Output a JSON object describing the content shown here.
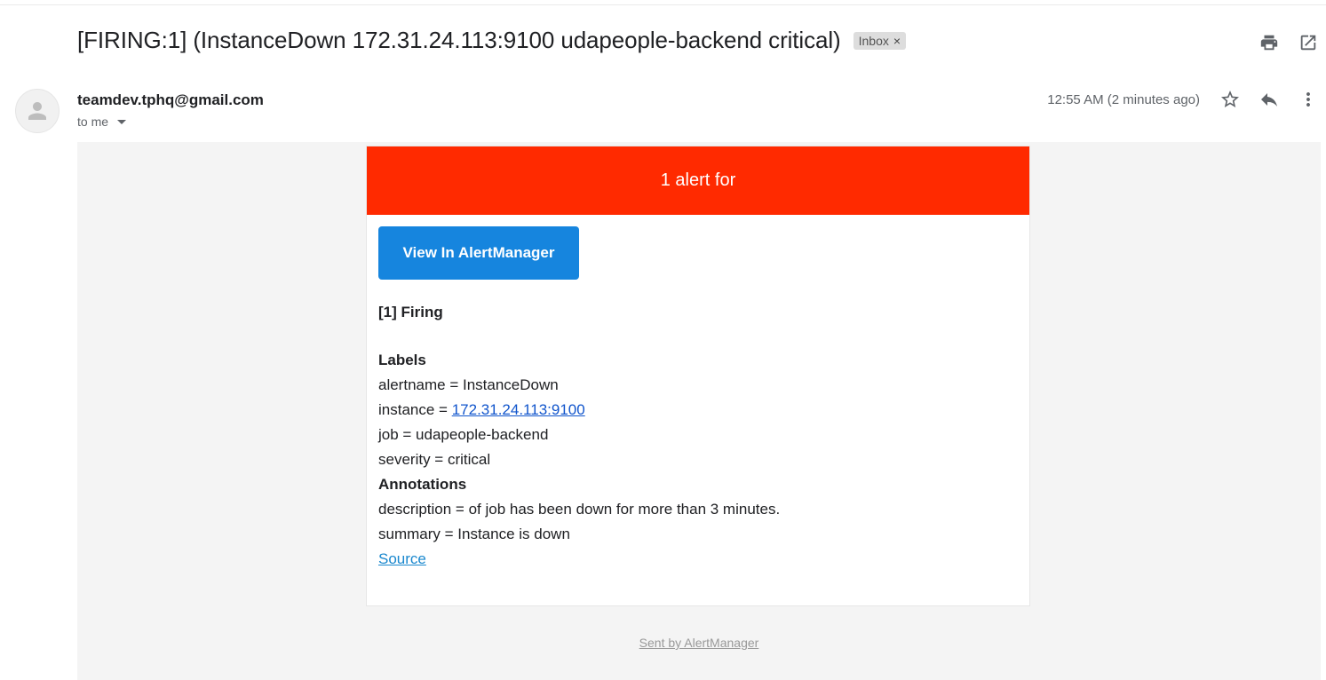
{
  "subject": {
    "title": "[FIRING:1] (InstanceDown 172.31.24.113:9100 udapeople-backend critical)",
    "label": "Inbox",
    "label_close": "×"
  },
  "toolbar": {
    "icons": [
      "print-icon",
      "open-in-new-window-icon"
    ]
  },
  "header": {
    "sender": "teamdev.tphq@gmail.com",
    "recipient": "to me",
    "timestamp": "12:55 AM (2 minutes ago)",
    "icons": [
      "star-icon",
      "reply-icon",
      "more-vert-icon"
    ]
  },
  "email": {
    "banner": "1 alert for",
    "button_label": "View In AlertManager",
    "firing_heading": "[1] Firing",
    "labels_heading": "Labels",
    "labels": {
      "alertname": "alertname = InstanceDown",
      "instance_prefix": "instance = ",
      "instance_link": "172.31.24.113:9100",
      "job": "job = udapeople-backend",
      "severity": "severity = critical"
    },
    "annotations_heading": "Annotations",
    "annotations": {
      "description": "description = of job has been down for more than 3 minutes.",
      "summary": "summary = Instance is down"
    },
    "source_link": "Source",
    "footer": "Sent by AlertManager"
  },
  "colors": {
    "banner": "#ff2a00",
    "button": "#1685de",
    "body_bg": "#f4f4f4",
    "link": "#1155cc"
  }
}
